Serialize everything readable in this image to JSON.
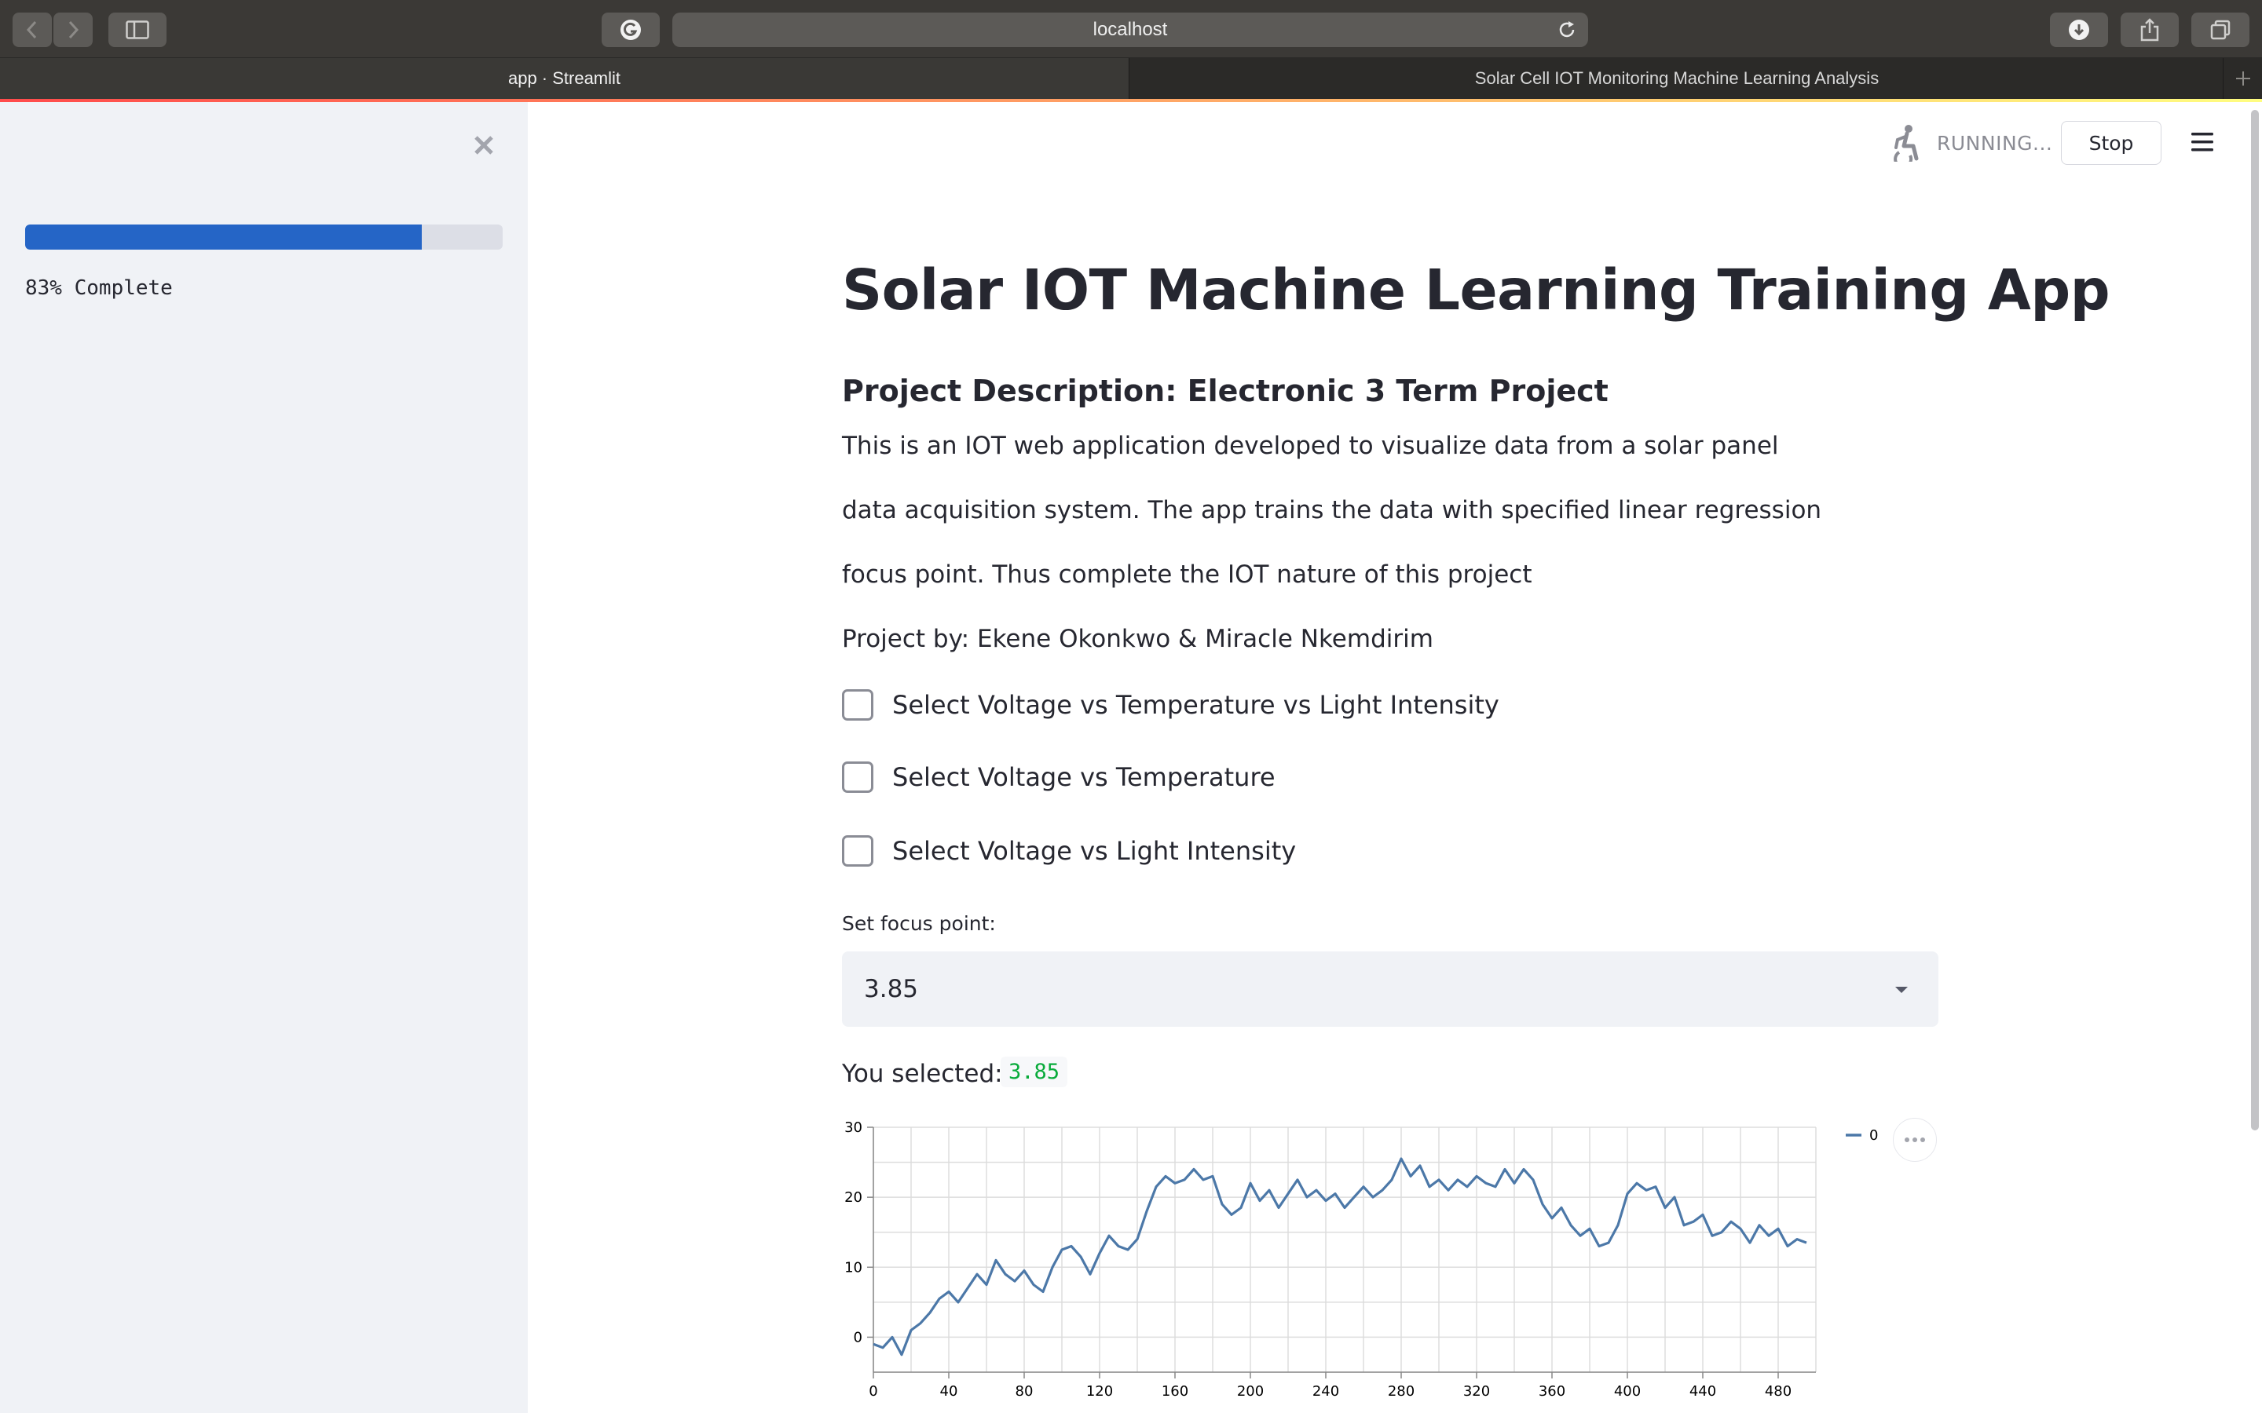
{
  "browser": {
    "url": "localhost",
    "tabs": [
      {
        "title": "app · Streamlit",
        "active": true
      },
      {
        "title": "Solar Cell IOT Monitoring Machine Learning Analysis",
        "active": false
      }
    ],
    "icons": [
      "back-icon",
      "forward-icon",
      "sidebar-toggle-icon",
      "grammarly-icon",
      "reload-icon",
      "download-icon",
      "share-icon",
      "tabs-overview-icon",
      "new-tab-icon"
    ]
  },
  "sidebar": {
    "progress_percent": 83,
    "progress_text": "83% Complete",
    "close_icon": "close-icon"
  },
  "header": {
    "status": "RUNNING...",
    "stop_label": "Stop",
    "status_icon": "running-person-icon",
    "menu_icon": "hamburger-menu-icon"
  },
  "main": {
    "title": "Solar IOT Machine Learning Training App",
    "subheading": "Project Description: Electronic 3 Term Project",
    "description_lines": [
      "This is an IOT web application developed to visualize data from a solar panel",
      "data acquisition system. The app trains the data with specified linear regression",
      "focus point. Thus complete the IOT nature of this project",
      "Project by: Ekene Okonkwo & Miracle Nkemdirim"
    ],
    "checkboxes": [
      {
        "label": "Select Voltage vs Temperature vs Light Intensity",
        "checked": false
      },
      {
        "label": "Select Voltage vs Temperature",
        "checked": false
      },
      {
        "label": "Select Voltage vs Light Intensity",
        "checked": false
      }
    ],
    "select": {
      "label": "Set focus point:",
      "value": "3.85"
    },
    "selected": {
      "label": "You selected:",
      "value": "3.85"
    }
  },
  "colors": {
    "primary": "#2565c6",
    "sidebar_bg": "#f0f2f6",
    "text": "#262730",
    "code_green": "#09ab3b",
    "line": "#4c78a8"
  },
  "chart_data": {
    "type": "line",
    "xlim": [
      0,
      500
    ],
    "ylim": [
      -5,
      30
    ],
    "x_ticks": [
      0,
      40,
      80,
      120,
      160,
      200,
      240,
      280,
      320,
      360,
      400,
      440,
      480
    ],
    "y_ticks": [
      0,
      10,
      20,
      30
    ],
    "grid": true,
    "legend_position": "top-right",
    "series": [
      {
        "name": "0",
        "color": "#4c78a8",
        "x": [
          0,
          5,
          10,
          15,
          20,
          25,
          30,
          35,
          40,
          45,
          50,
          55,
          60,
          65,
          70,
          75,
          80,
          85,
          90,
          95,
          100,
          105,
          110,
          115,
          120,
          125,
          130,
          135,
          140,
          145,
          150,
          155,
          160,
          165,
          170,
          175,
          180,
          185,
          190,
          195,
          200,
          205,
          210,
          215,
          220,
          225,
          230,
          235,
          240,
          245,
          250,
          255,
          260,
          265,
          270,
          275,
          280,
          285,
          290,
          295,
          300,
          305,
          310,
          315,
          320,
          325,
          330,
          335,
          340,
          345,
          350,
          355,
          360,
          365,
          370,
          375,
          380,
          385,
          390,
          395,
          400,
          405,
          410,
          415,
          420,
          425,
          430,
          435,
          440,
          445,
          450,
          455,
          460,
          465,
          470,
          475,
          480,
          485,
          490,
          495
        ],
        "y": [
          -1,
          -1.5,
          0,
          -2.5,
          1,
          2,
          3.5,
          5.5,
          6.5,
          5,
          7,
          9,
          7.5,
          11,
          9,
          8,
          9.5,
          7.5,
          6.5,
          10,
          12.5,
          13,
          11.5,
          9,
          12,
          14.5,
          13,
          12.5,
          14,
          18,
          21.5,
          23,
          22,
          22.5,
          24,
          22.5,
          23,
          19,
          17.5,
          18.5,
          22,
          19.5,
          21,
          18.5,
          20.5,
          22.5,
          20,
          21,
          19.5,
          20.5,
          18.5,
          20,
          21.5,
          20,
          21,
          22.5,
          25.5,
          23,
          24.5,
          21.5,
          22.5,
          21,
          22.5,
          21.5,
          23,
          22,
          21.5,
          24,
          22,
          24,
          22.5,
          19,
          17,
          18.5,
          16,
          14.5,
          15.5,
          13,
          13.5,
          16,
          20.5,
          22,
          21,
          21.5,
          18.5,
          20,
          16,
          16.5,
          17.5,
          14.5,
          15,
          16.5,
          15.5,
          13.5,
          16,
          14.5,
          15.5,
          13,
          14,
          13.5
        ]
      }
    ]
  }
}
